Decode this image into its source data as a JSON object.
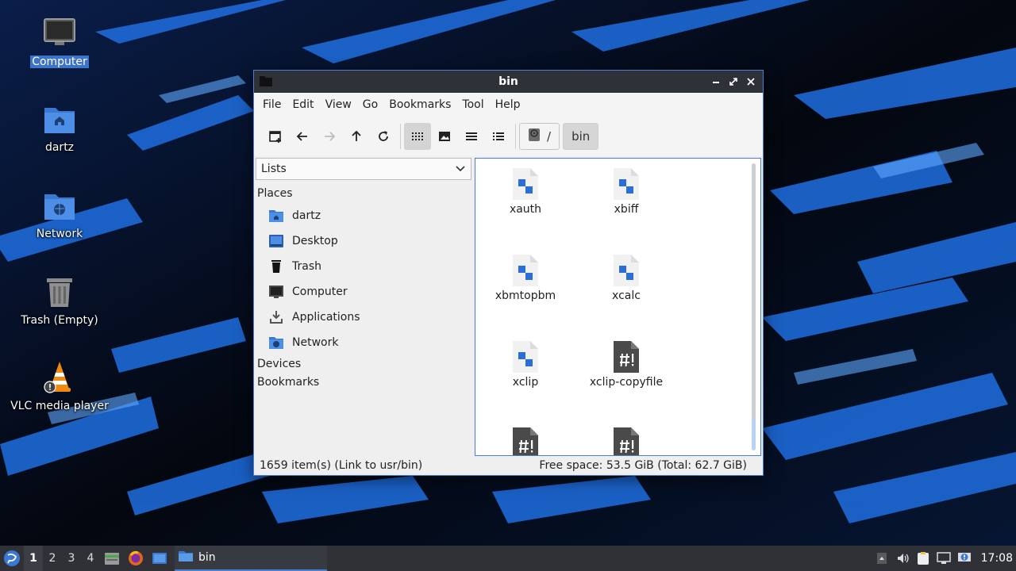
{
  "desktop": {
    "icons": [
      {
        "label": "Computer",
        "icon": "computer-icon"
      },
      {
        "label": "dartz",
        "icon": "home-folder-icon"
      },
      {
        "label": "Network",
        "icon": "network-folder-icon"
      },
      {
        "label": "Trash (Empty)",
        "icon": "trash-icon"
      },
      {
        "label": "VLC media player",
        "icon": "vlc-icon"
      }
    ]
  },
  "window": {
    "title": "bin",
    "menu": [
      "File",
      "Edit",
      "View",
      "Go",
      "Bookmarks",
      "Tool",
      "Help"
    ],
    "path": {
      "root": "/",
      "current": "bin"
    },
    "side_panel_mode": "Lists",
    "sidebar": {
      "places_header": "Places",
      "places": [
        {
          "label": "dartz",
          "icon": "home-folder-icon"
        },
        {
          "label": "Desktop",
          "icon": "desktop-icon"
        },
        {
          "label": "Trash",
          "icon": "trash-icon"
        },
        {
          "label": "Computer",
          "icon": "computer-icon"
        },
        {
          "label": "Applications",
          "icon": "applications-icon"
        },
        {
          "label": "Network",
          "icon": "network-icon"
        }
      ],
      "devices_header": "Devices",
      "bookmarks_header": "Bookmarks"
    },
    "files": [
      {
        "name": "xauth",
        "icon": "executable-file-icon"
      },
      {
        "name": "xbiff",
        "icon": "executable-file-icon"
      },
      {
        "name": "xbmtopbm",
        "icon": "executable-file-icon"
      },
      {
        "name": "xcalc",
        "icon": "executable-file-icon"
      },
      {
        "name": "xclip",
        "icon": "executable-file-icon"
      },
      {
        "name": "xclip-copyfile",
        "icon": "script-file-icon"
      },
      {
        "name": "",
        "icon": "script-file-icon"
      },
      {
        "name": "",
        "icon": "script-file-icon"
      }
    ],
    "status": {
      "items": "1659 item(s) (Link to usr/bin)",
      "free_space": "Free space: 53.5 GiB (Total: 62.7 GiB)"
    }
  },
  "taskbar": {
    "workspaces": [
      "1",
      "2",
      "3",
      "4"
    ],
    "active_workspace": "1",
    "task_label": "bin",
    "clock": "17:08"
  },
  "colors": {
    "accent": "#4a7fcf",
    "titlebar": "#2e3138",
    "taskbar": "#2f3136",
    "selection": "#3d73c8"
  }
}
